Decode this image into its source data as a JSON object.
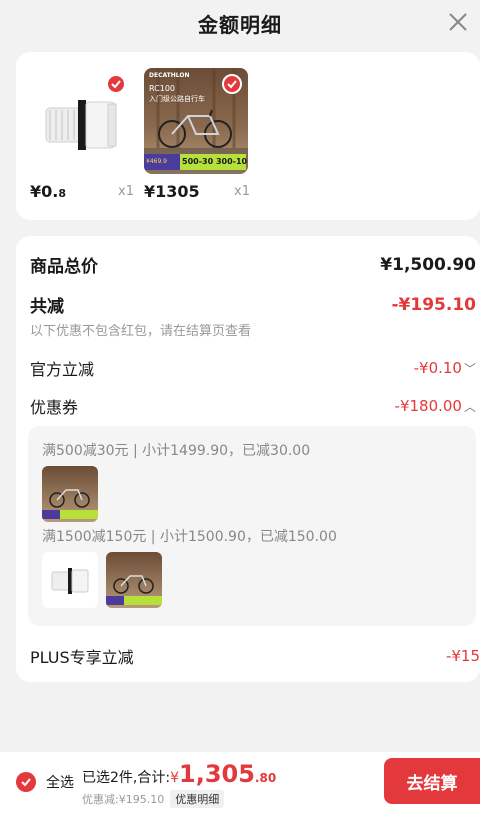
{
  "header": {
    "title": "金额明细"
  },
  "products": [
    {
      "price_main": "¥0.",
      "price_decimal": "8",
      "qty": "x1"
    },
    {
      "price_main": "¥1305",
      "price_decimal": "",
      "qty": "x1",
      "thumb_brand": "DECATHLON",
      "thumb_model": "RC100",
      "thumb_caption": "入门级公路自行车",
      "thumb_promo": "500-30 300-10",
      "thumb_price": "¥469.9"
    }
  ],
  "details": {
    "total_label": "商品总价",
    "total_value": "¥1,500.90",
    "discount_label": "共减",
    "discount_value": "-¥195.10",
    "discount_note": "以下优惠不包含红包，请在结算页查看",
    "official_label": "官方立减",
    "official_value": "-¥0.10",
    "coupon_label": "优惠券",
    "coupon_value": "-¥180.00",
    "coupon_group1": "满500减30元 | 小计1499.90，已减30.00",
    "coupon_group2": "满1500减150元 | 小计1500.90，已减150.00",
    "plus_label": "PLUS专享立减",
    "plus_value": "-¥15"
  },
  "bottom": {
    "select_all": "全选",
    "selected_text": "已选2件,合计:",
    "yen": "¥",
    "total_int": "1,305",
    "total_dec": ".80",
    "discount_text": "优惠减:¥195.10",
    "detail_label": "优惠明细",
    "checkout": "去结算"
  },
  "colors": {
    "accent": "#e4393c",
    "background": "#f2f2f2"
  }
}
